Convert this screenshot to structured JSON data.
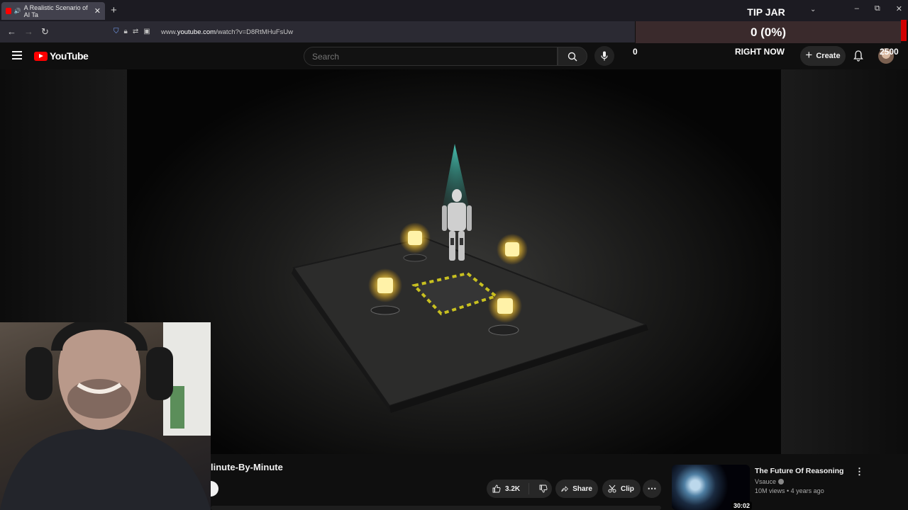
{
  "browser": {
    "tab_title": "A Realistic Scenario of AI Ta",
    "tab_close": "✕",
    "new_tab": "+",
    "url_prefix": "www.",
    "url_domain": "youtube.com",
    "url_path": "/watch?v=D8RtMHuFsUw",
    "nav": {
      "back": "←",
      "forward": "→",
      "reload": "↻"
    },
    "window_controls": {
      "minimize": "–",
      "restore": "⧉",
      "close": "✕"
    }
  },
  "tip_jar": {
    "title": "TIP JAR",
    "current": "0 (0%)",
    "progress_fraction": 0,
    "min_label": "0",
    "now_label": "RIGHT NOW",
    "max_label": "2500",
    "accent_color": "#d10000"
  },
  "youtube": {
    "logo_text": "YouTube",
    "search_placeholder": "Search",
    "create_label": "Create",
    "brand_color": "#ff0000"
  },
  "video": {
    "title_visible": "linute-By-Minute",
    "likes": "3.2K",
    "share_label": "Share",
    "clip_label": "Clip",
    "more_label": "⋯"
  },
  "recommended": {
    "title": "The Future Of Reasoning",
    "channel": "Vsauce",
    "meta": "10M views • 4 years ago",
    "duration": "30:02"
  }
}
